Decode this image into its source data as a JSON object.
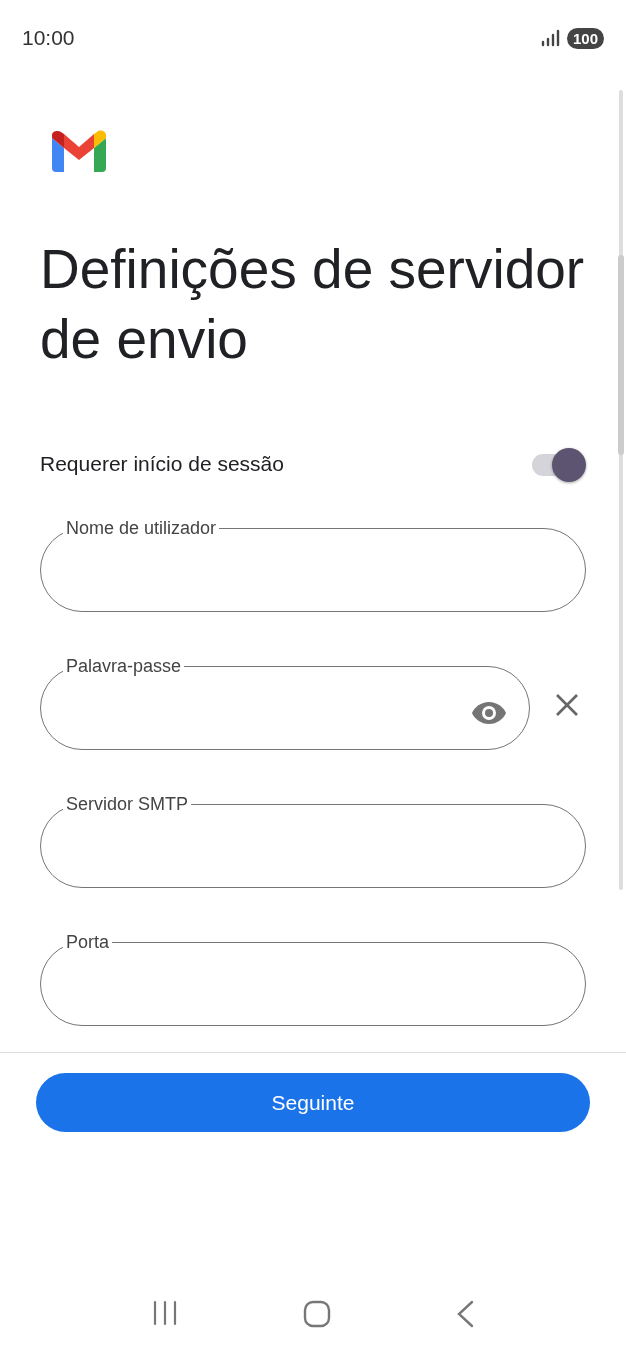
{
  "status_bar": {
    "time": "10:00",
    "battery": "100"
  },
  "title": "Definições de servidor de envio",
  "sign_in_toggle": {
    "label": "Requerer início de sessão",
    "on": true
  },
  "fields": [
    {
      "kind": "text",
      "label": "Nome de utilizador"
    },
    {
      "kind": "password",
      "label": "Palavra-passe"
    },
    {
      "kind": "text",
      "label": "Servidor SMTP"
    },
    {
      "kind": "text",
      "label": "Porta"
    }
  ],
  "next_button": "Seguinte"
}
